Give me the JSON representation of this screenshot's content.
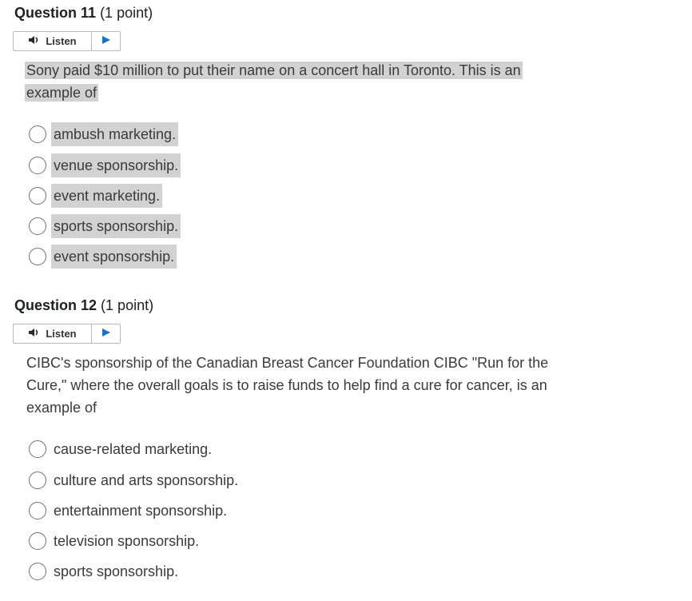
{
  "questions": [
    {
      "number_label": "Question 11",
      "points": "(1 point)",
      "listen_label": "Listen",
      "stem_line1": "Sony paid $10 million to put their name on a concert hall in Toronto. This is an",
      "stem_line2": "example of",
      "highlighted": true,
      "options": [
        "ambush marketing.",
        "venue sponsorship.",
        "event marketing.",
        "sports sponsorship.",
        "event sponsorship."
      ]
    },
    {
      "number_label": "Question 12",
      "points": "(1 point)",
      "listen_label": "Listen",
      "stem_line1": "CIBC's sponsorship of the Canadian Breast Cancer Foundation CIBC \"Run for the",
      "stem_line2": "Cure,\" where the overall goals is to raise funds to help find a cure for cancer, is an",
      "stem_line3": "example of",
      "highlighted": false,
      "options": [
        "cause-related marketing.",
        "culture and arts sponsorship.",
        "entertainment sponsorship.",
        "television sponsorship.",
        "sports sponsorship."
      ]
    }
  ],
  "icons": {
    "speaker": "speaker-icon",
    "play": "play-icon"
  },
  "colors": {
    "highlight": "#d2d2d2",
    "play_triangle": "#1f6fbf"
  }
}
